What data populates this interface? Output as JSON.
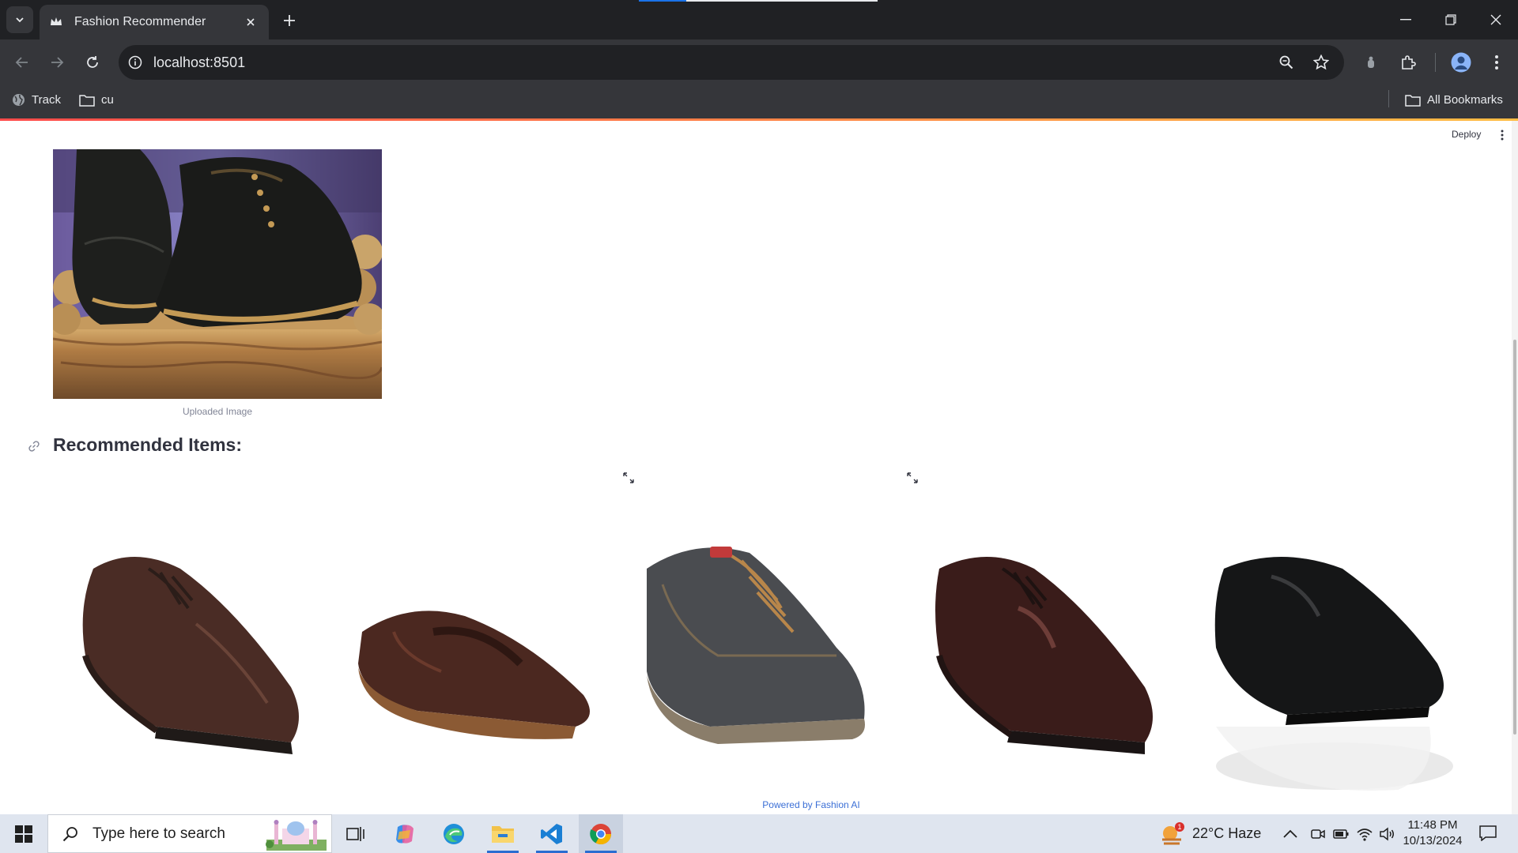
{
  "browser": {
    "tab_title": "Fashion Recommender",
    "url": "localhost:8501",
    "bookmarks": [
      {
        "label": "Track",
        "icon": "globe-icon"
      },
      {
        "label": "cu",
        "icon": "folder-icon"
      }
    ],
    "all_bookmarks_label": "All Bookmarks"
  },
  "app": {
    "deploy_label": "Deploy",
    "uploaded_caption": "Uploaded Image",
    "section_heading": "Recommended Items:",
    "footer_text": "Powered by Fashion AI",
    "recommendations": [
      {
        "icon": "brown-derby-shoe-icon"
      },
      {
        "icon": "brown-loafer-shoe-icon"
      },
      {
        "icon": "grey-casual-boot-icon"
      },
      {
        "icon": "dark-brown-derby-shoe-icon"
      },
      {
        "icon": "black-slip-on-shoe-icon"
      }
    ]
  },
  "taskbar": {
    "search_placeholder": "Type here to search",
    "weather": "22°C  Haze",
    "weather_alert": "1",
    "time": "11:48 PM",
    "date": "10/13/2024"
  },
  "colors": {
    "accent_gradient_start": "#ff4b4b",
    "accent_gradient_end": "#ffbd45",
    "footer_link": "#3b6fd6"
  }
}
